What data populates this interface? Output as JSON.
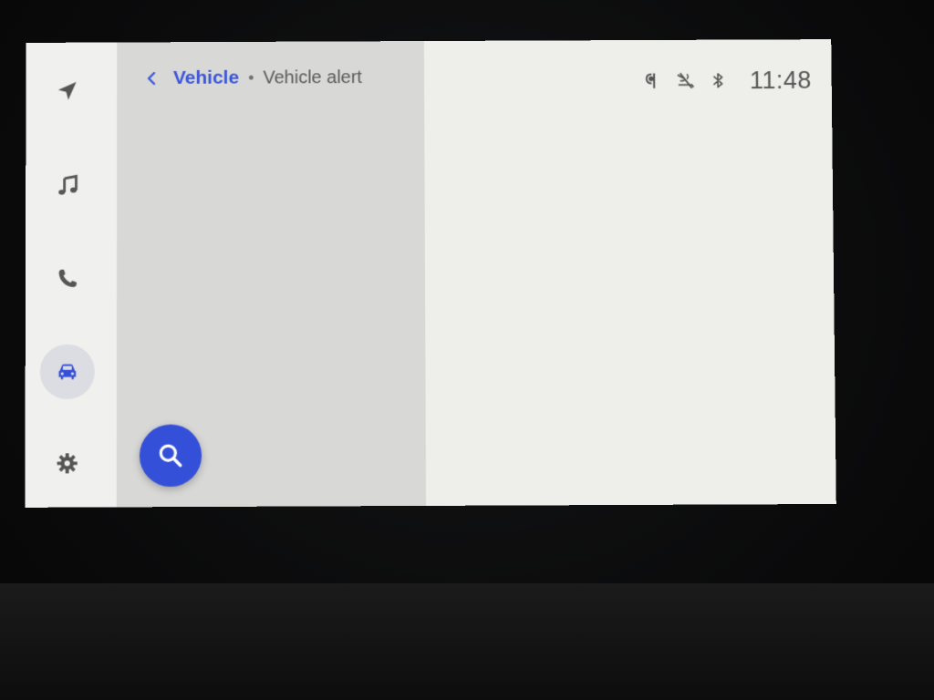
{
  "breadcrumb": {
    "parent": "Vehicle",
    "separator": "•",
    "current": "Vehicle alert"
  },
  "status": {
    "time": "11:48",
    "icons": [
      "wireless-charging-icon",
      "mic-off-icon",
      "bluetooth-icon"
    ]
  },
  "rail": {
    "items": [
      {
        "name": "navigation",
        "icon": "navigation-arrow-icon"
      },
      {
        "name": "music",
        "icon": "music-note-icon"
      },
      {
        "name": "phone",
        "icon": "phone-icon"
      },
      {
        "name": "vehicle",
        "icon": "car-icon",
        "active": true
      },
      {
        "name": "settings",
        "icon": "gear-icon"
      }
    ]
  },
  "fab": {
    "icon": "search-icon"
  },
  "colors": {
    "accent": "#3550d8",
    "rail_bg": "#f0f0ee",
    "left_pane_bg": "#d8d8d6",
    "right_pane_bg": "#eeeeea",
    "active_highlight": "#dcdde3"
  }
}
